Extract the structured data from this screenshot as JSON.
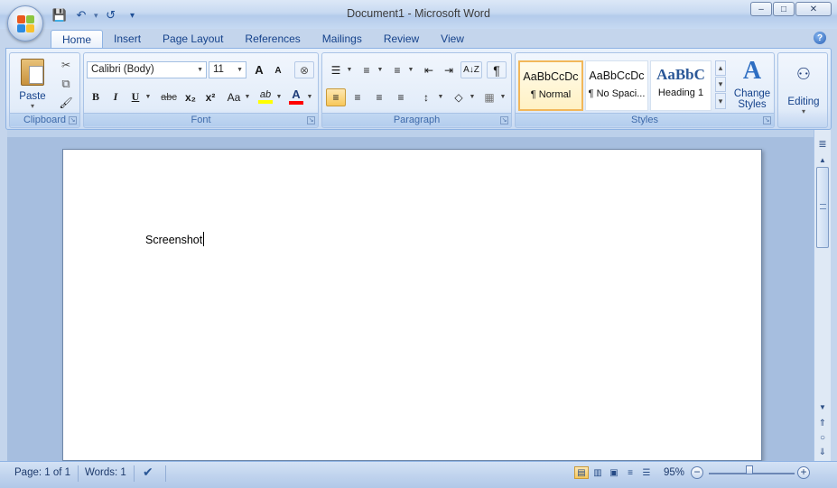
{
  "window": {
    "title": "Document1 - Microsoft Word",
    "controls": {
      "minimize": "–",
      "maximize": "□",
      "close": "✕"
    }
  },
  "quick_access": {
    "save_icon": "💾",
    "undo_icon": "↶",
    "redo_icon": "↺",
    "customize_icon": "▾"
  },
  "tabs": [
    "Home",
    "Insert",
    "Page Layout",
    "References",
    "Mailings",
    "Review",
    "View"
  ],
  "active_tab": "Home",
  "help": "?",
  "ribbon": {
    "clipboard": {
      "label": "Clipboard",
      "paste_label": "Paste",
      "paste_arrow": "▾",
      "cut_icon": "✂",
      "copy_icon": "⧉",
      "format_painter_icon": "🖌"
    },
    "font": {
      "label": "Font",
      "font_name": "Calibri (Body)",
      "font_size": "11",
      "grow_label": "A",
      "shrink_label": "A",
      "clear_label": "⊗",
      "bold": "B",
      "italic": "I",
      "underline": "U",
      "strike": "abc",
      "subscript": "x₂",
      "superscript": "x²",
      "change_case": "Aa",
      "highlight": "ab",
      "font_color": "A",
      "highlight_color": "#ffff00",
      "font_color_value": "#ff0000"
    },
    "paragraph": {
      "label": "Paragraph",
      "bullets": "☰",
      "numbering": "≡",
      "multilevel": "≡",
      "decrease_indent": "⇤",
      "increase_indent": "⇥",
      "sort": "A↓Z",
      "show_marks": "¶",
      "align_left": "≡",
      "center": "≡",
      "align_right": "≡",
      "justify": "≡",
      "line_spacing": "↕",
      "shading": "◇",
      "borders": "▦"
    },
    "styles": {
      "label": "Styles",
      "items": [
        {
          "sample": "AaBbCcDc",
          "name": "¶ Normal"
        },
        {
          "sample": "AaBbCcDc",
          "name": "¶ No Spaci..."
        },
        {
          "sample": "AaBbC",
          "name": "Heading 1"
        }
      ],
      "change_styles_line1": "Change",
      "change_styles_line2": "Styles",
      "change_styles_icon": "A",
      "scroll_up": "▴",
      "scroll_down": "▾",
      "more": "▾"
    },
    "editing": {
      "label": "Editing",
      "icon": "⚇",
      "arrow": "▾"
    }
  },
  "document": {
    "text": "Screenshot"
  },
  "scrollbar": {
    "ruler_toggle": "≣",
    "up": "▲",
    "down": "▼",
    "prev_page": "⇑",
    "select_browse": "○",
    "next_page": "⇓"
  },
  "status": {
    "page": "Page: 1 of 1",
    "words": "Words: 1",
    "proofing_icon": "✔",
    "zoom": "95%",
    "zoom_level": 0.95,
    "zoom_out": "−",
    "zoom_in": "+",
    "views": [
      "▤",
      "▥",
      "▣",
      "≡",
      "☰"
    ]
  }
}
